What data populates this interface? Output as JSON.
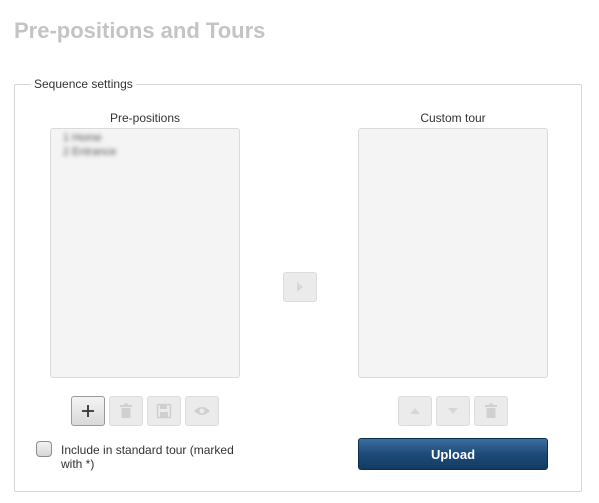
{
  "page": {
    "title": "Pre-positions and Tours"
  },
  "sequence": {
    "legend": "Sequence settings",
    "prepositions_label": "Pre-positions",
    "custom_tour_label": "Custom tour",
    "prepositions_items": [
      "1 Home",
      "2 Entrance"
    ],
    "custom_tour_items": []
  },
  "icons": {
    "add": "plus-icon",
    "remove": "trash-icon",
    "save": "floppy-disk-icon",
    "preview": "eye-icon",
    "transfer": "arrow-right-icon",
    "move_up": "arrow-up-icon",
    "move_down": "arrow-down-icon",
    "delete": "trash-icon"
  },
  "include": {
    "label": "Include in standard tour (marked with *)",
    "checked": false
  },
  "upload": {
    "label": "Upload"
  },
  "colors": {
    "title": "#c4c4c4",
    "upload_bg": "#1d4b78",
    "list_bg": "#f4f4f4"
  }
}
